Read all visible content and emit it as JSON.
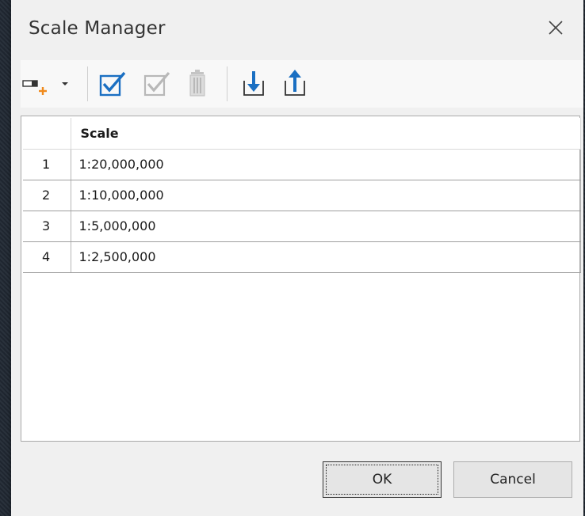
{
  "dialog": {
    "title": "Scale Manager",
    "close_icon": "close-icon"
  },
  "toolbar": {
    "items": [
      {
        "name": "add-scale-icon",
        "tooltip": ""
      },
      {
        "name": "select-all-icon"
      },
      {
        "name": "select-none-icon"
      },
      {
        "name": "delete-icon"
      },
      {
        "name": "import-icon"
      },
      {
        "name": "export-icon"
      }
    ],
    "accent_color": "#1a6fc2",
    "add_color": "#f08a1c",
    "disabled_color": "#b8b8b8"
  },
  "table": {
    "header": {
      "index": "",
      "scale": "Scale"
    },
    "rows": [
      {
        "index": "1",
        "scale": "1:20,000,000"
      },
      {
        "index": "2",
        "scale": "1:10,000,000"
      },
      {
        "index": "3",
        "scale": "1:5,000,000"
      },
      {
        "index": "4",
        "scale": "1:2,500,000"
      }
    ]
  },
  "buttons": {
    "ok_label": "OK",
    "cancel_label": "Cancel"
  }
}
